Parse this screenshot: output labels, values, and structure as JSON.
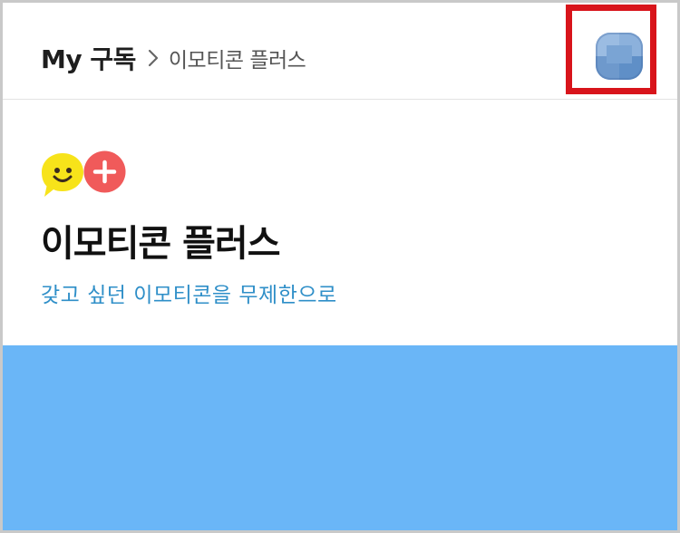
{
  "header": {
    "breadcrumb": {
      "root": "My 구독",
      "separator_icon": "chevron-right-icon",
      "current": "이모티콘 플러스"
    },
    "profile": {
      "icon": "profile-avatar-icon",
      "highlight_color": "#d8141b"
    }
  },
  "hero": {
    "logo_icons": [
      "smile-speech-bubble-icon",
      "plus-circle-icon"
    ],
    "title": "이모티콘 플러스",
    "subtitle": "갖고 싶던 이모티콘을 무제한으로"
  },
  "colors": {
    "subtitle": "#2f8fc8",
    "banner": "#6ab6f7",
    "smile_yellow": "#f7e31a",
    "plus_red": "#f05a5a"
  }
}
